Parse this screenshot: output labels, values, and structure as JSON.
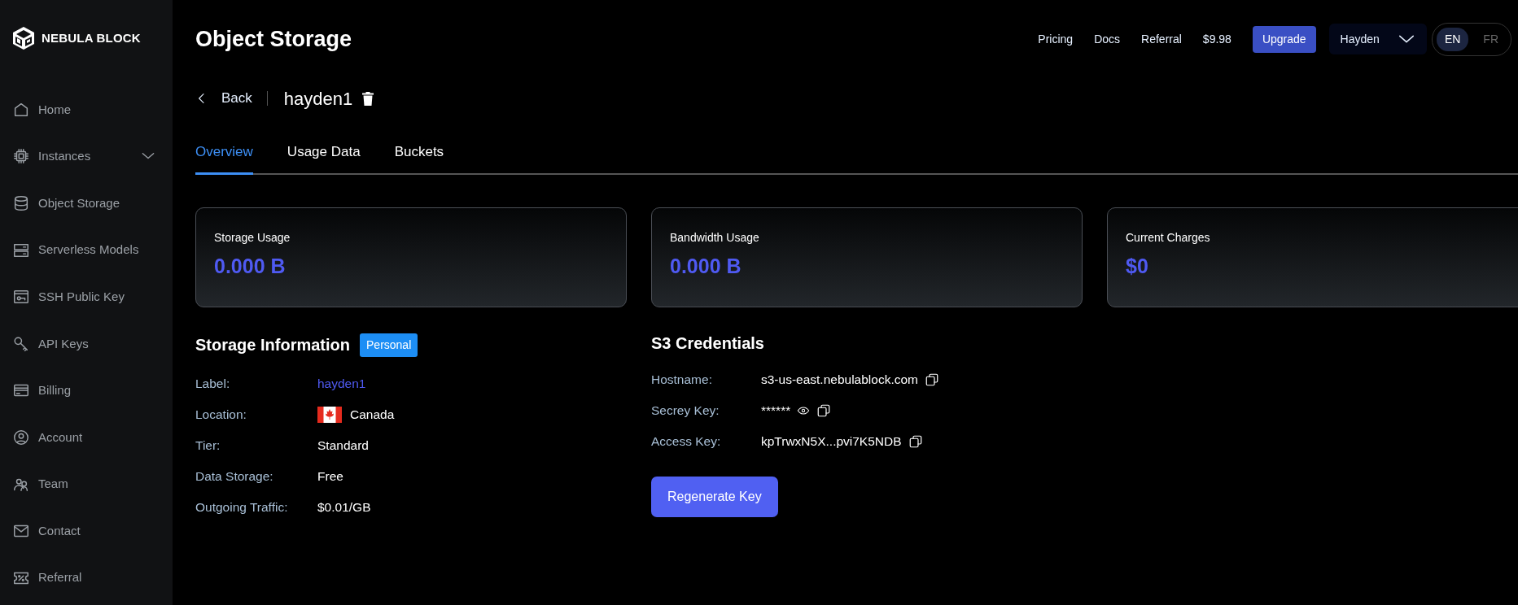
{
  "brand": {
    "name": "NEBULA BLOCK"
  },
  "sidebar": {
    "items": [
      {
        "label": "Home",
        "kind": "link"
      },
      {
        "label": "Instances",
        "kind": "group"
      },
      {
        "label": "Object Storage",
        "kind": "link"
      },
      {
        "label": "Serverless Models",
        "kind": "link"
      },
      {
        "label": "SSH Public Key",
        "kind": "link"
      },
      {
        "label": "API Keys",
        "kind": "link"
      },
      {
        "label": "Billing",
        "kind": "link"
      },
      {
        "label": "Account",
        "kind": "link"
      },
      {
        "label": "Team",
        "kind": "link"
      },
      {
        "label": "Contact",
        "kind": "link"
      },
      {
        "label": "Referral",
        "kind": "link"
      }
    ]
  },
  "header": {
    "title": "Object Storage",
    "links": [
      "Pricing",
      "Docs",
      "Referral"
    ],
    "balance": "$9.98",
    "upgrade": "Upgrade",
    "user": "Hayden",
    "languages": [
      {
        "label": "EN",
        "selected": true
      },
      {
        "label": "FR",
        "selected": false
      }
    ]
  },
  "breadcrumb": {
    "back": "Back",
    "name": "hayden1"
  },
  "tabs": [
    {
      "label": "Overview",
      "selected": true
    },
    {
      "label": "Usage Data",
      "selected": false
    },
    {
      "label": "Buckets",
      "selected": false
    }
  ],
  "cards": [
    {
      "title": "Storage Usage",
      "value": "0.000 B"
    },
    {
      "title": "Bandwidth Usage",
      "value": "0.000 B"
    },
    {
      "title": "Current Charges",
      "value": "$0"
    }
  ],
  "storage_info": {
    "title": "Storage Information",
    "badge": "Personal",
    "rows": [
      {
        "label": "Label:",
        "value": "hayden1",
        "kind": "link"
      },
      {
        "label": "Location:",
        "value": "Canada",
        "kind": "flag"
      },
      {
        "label": "Tier:",
        "value": "Standard",
        "kind": "text"
      },
      {
        "label": "Data Storage:",
        "value": "Free",
        "kind": "text"
      },
      {
        "label": "Outgoing Traffic:",
        "value": "$0.01/GB",
        "kind": "text"
      }
    ]
  },
  "credentials": {
    "title": "S3 Credentials",
    "rows": [
      {
        "label": "Hostname:",
        "value": "s3-us-east.nebulablock.com",
        "kind": "copy"
      },
      {
        "label": "Secrey Key:",
        "value": "******",
        "kind": "secret"
      },
      {
        "label": "Access Key:",
        "value": "kpTrwxN5X...pvi7K5NDB",
        "kind": "copy"
      }
    ],
    "button": "Regenerate Key"
  }
}
